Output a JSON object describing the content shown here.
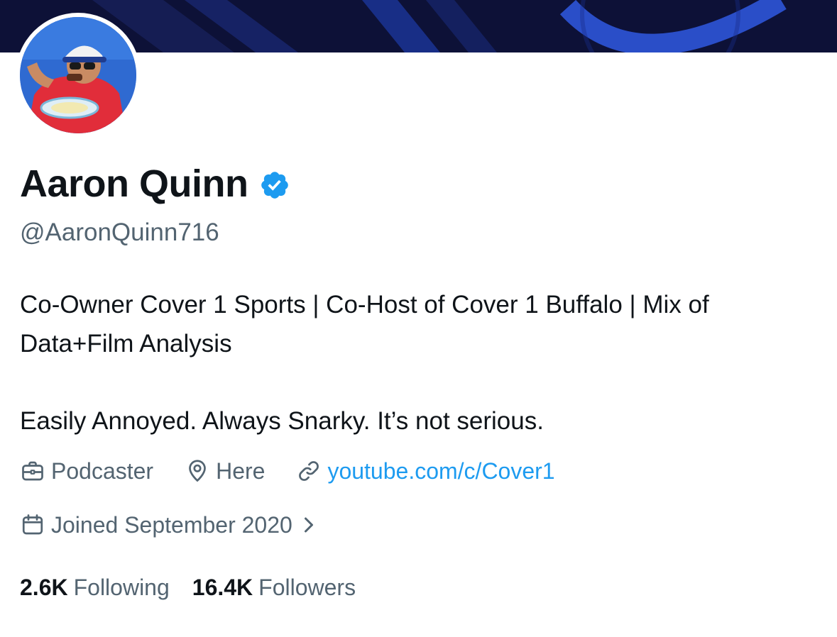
{
  "profile": {
    "display_name": "Aaron Quinn",
    "handle": "@AaronQuinn716",
    "verified": true,
    "bio_line1": "Co-Owner Cover 1 Sports | Co-Host of Cover 1 Buffalo | Mix of Data+Film Analysis",
    "bio_line2": "Easily Annoyed. Always Snarky. It’s not serious."
  },
  "meta": {
    "profession": {
      "icon": "briefcase-icon",
      "label": "Podcaster"
    },
    "location": {
      "icon": "location-pin-icon",
      "label": "Here"
    },
    "website": {
      "icon": "link-icon",
      "label": "youtube.com/c/Cover1"
    },
    "joined": {
      "icon": "calendar-icon",
      "label": "Joined September 2020"
    }
  },
  "stats": {
    "following_count": "2.6K",
    "following_label": "Following",
    "followers_count": "16.4K",
    "followers_label": "Followers"
  },
  "colors": {
    "text_primary": "#0f1419",
    "text_secondary": "#536471",
    "link": "#1d9bf0",
    "verified_badge": "#1d9bf0",
    "banner": "#0d1137"
  }
}
